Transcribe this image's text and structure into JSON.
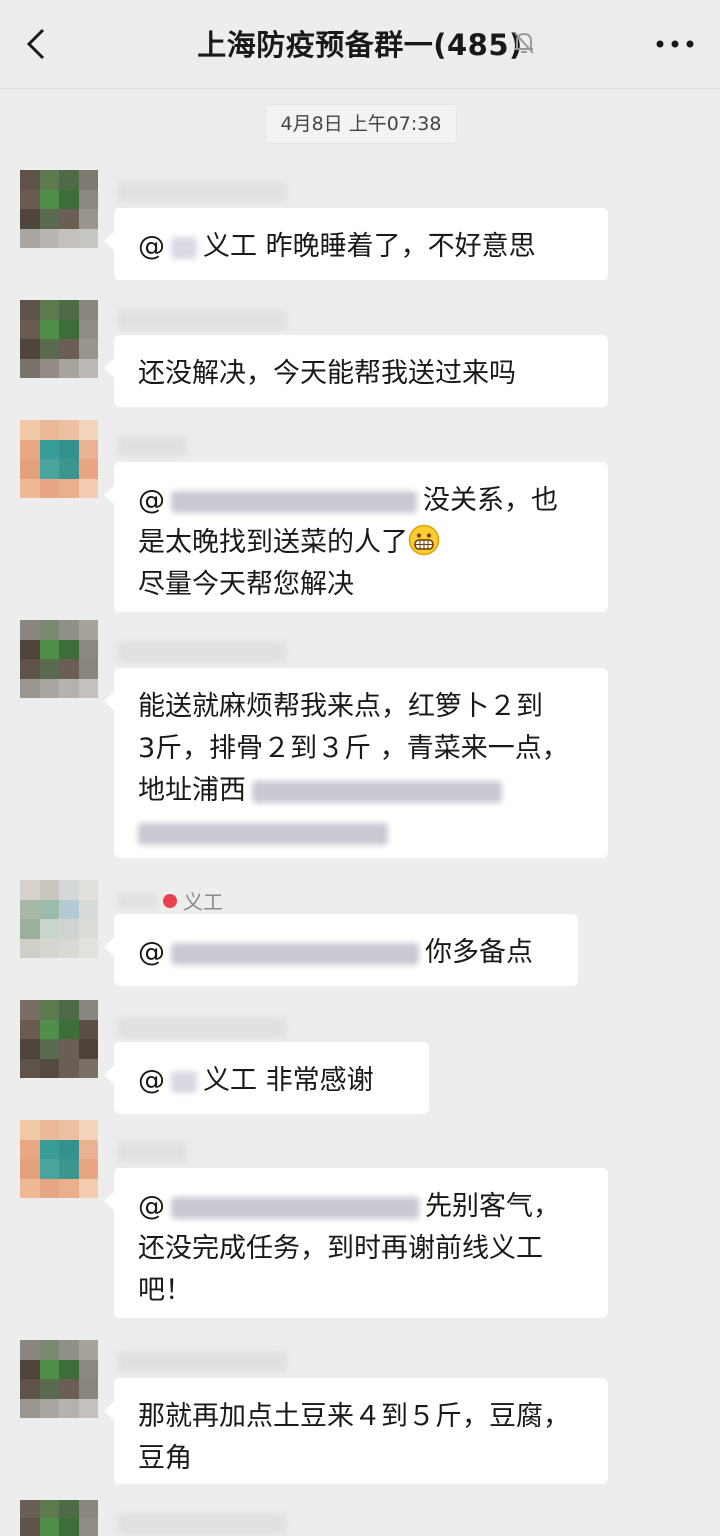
{
  "header": {
    "title": "上海防疫预备群一(485)",
    "back_icon": "chevron-left-icon",
    "mute_icon": "bell-off-icon",
    "more_icon": "more-dots-icon"
  },
  "timestamp": "4月8日 上午07:38",
  "messages": [
    {
      "sender_tag": "",
      "lines": [
        "@",
        "义工  昨晚睡着了，不好意思"
      ]
    },
    {
      "sender_tag": "",
      "lines": [
        "还没解决，今天能帮我送过来吗"
      ]
    },
    {
      "sender_tag": "",
      "lines": [
        "@",
        "没关系，也",
        "是太晚找到送菜的人了",
        "尽量今天帮您解决"
      ]
    },
    {
      "sender_tag": "",
      "lines": [
        "能送就麻烦帮我来点，红箩卜２到",
        "3斤，排骨２到３斤 ，青菜来一点，",
        "地址浦西"
      ]
    },
    {
      "sender_tag": "义工",
      "lines": [
        "@",
        "你多备点"
      ]
    },
    {
      "sender_tag": "",
      "lines": [
        "@",
        "义工  非常感谢"
      ]
    },
    {
      "sender_tag": "",
      "lines": [
        "@",
        "先别客气，",
        "还没完成任务，到时再谢前线义工",
        "吧！"
      ]
    },
    {
      "sender_tag": "",
      "lines": [
        "那就再加点土豆来４到５斤，豆腐，",
        "豆角"
      ]
    }
  ],
  "colors": {
    "background": "#ededed",
    "bubble": "#ffffff",
    "text": "#191919"
  }
}
